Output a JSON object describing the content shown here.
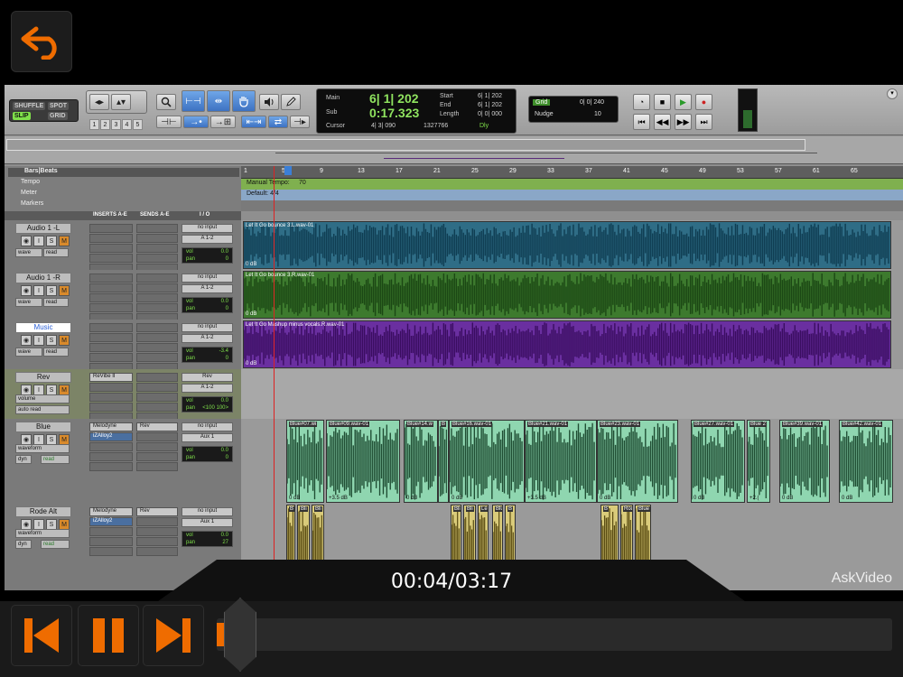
{
  "player": {
    "time_display": "00:04/03:17",
    "progress": 0.02,
    "watermark": "AskVideo",
    "back_icon": "back-arrow-icon",
    "accent": "#ef6c00"
  },
  "toolbar": {
    "modes": {
      "shuffle": "SHUFFLE",
      "spot": "SPOT",
      "slip": "SLIP",
      "grid": "GRID"
    },
    "zoom_presets": [
      "1",
      "2",
      "3",
      "4",
      "5"
    ],
    "counter": {
      "main_label": "Main",
      "main_value": "6| 1| 202",
      "sub_label": "Sub",
      "sub_value": "0:17.323",
      "cursor_label": "Cursor",
      "cursor_value": "4| 3| 090",
      "cursor_extra": "1327766",
      "start_label": "Start",
      "start_value": "6| 1| 202",
      "end_label": "End",
      "end_value": "6| 1| 202",
      "length_label": "Length",
      "length_value": "0| 0| 000",
      "dly": "Dly"
    },
    "grid": {
      "label": "Grid",
      "value": "0| 0| 240",
      "nudge_label": "Nudge",
      "nudge_value": "10"
    }
  },
  "rulers": {
    "bars_beats": "Bars|Beats",
    "tempo": "Tempo",
    "meter": "Meter",
    "markers": "Markers",
    "tempo_text": "Manual Tempo:",
    "tempo_value": "70",
    "meter_text": "Default: 4/4",
    "ticks": [
      "1",
      "5",
      "9",
      "13",
      "17",
      "21",
      "25",
      "29",
      "33",
      "37",
      "41",
      "45",
      "49",
      "53",
      "57",
      "61",
      "65"
    ]
  },
  "mix_columns": {
    "inserts": "INSERTS A-E",
    "sends": "SENDS A-E",
    "io": "I / O"
  },
  "tracks": [
    {
      "name": "Audio 1 -L",
      "mode": "wave",
      "mode2": "read",
      "input": "no input",
      "output": "A 1-2",
      "vol": "0.0",
      "pan": "0",
      "region": "Let It Go bounce 3.L.wav-01",
      "gain": "0 dB"
    },
    {
      "name": "Audio 1 -R",
      "mode": "wave",
      "mode2": "read",
      "input": "no input",
      "output": "A 1-2",
      "vol": "0.0",
      "pan": "0",
      "region": "Let It Go bounce 3.R.wav-01",
      "gain": "0 dB"
    },
    {
      "name": "Music",
      "mode": "wave",
      "mode2": "read",
      "input": "no input",
      "output": "A 1-2",
      "vol": "-3.4",
      "pan": "0",
      "region": "Let It Go Mashup minus vocals.R.wav-01",
      "gain": "0 dB"
    },
    {
      "name": "Rev",
      "insert": "ReVibe II",
      "mode": "volume",
      "mode2": "auto read",
      "input": "Rev",
      "output": "A 1-2",
      "vol": "0.0",
      "pan": "<100  100>"
    },
    {
      "name": "Blue",
      "insert": "Melodyne",
      "insert2": "iZAlloy2",
      "send": "Rev",
      "mode": "waveform",
      "mode2": "dyn",
      "mode3": "read",
      "input": "no input",
      "output": "Aux 1",
      "vol": "0.0",
      "pan": "0",
      "regions": [
        {
          "name": "Blue#07.wi",
          "gain": "0 dB"
        },
        {
          "name": "Blue#09.wav-01",
          "gain": "+3.5 dB"
        },
        {
          "name": "Blue#14.w",
          "gain": "0 dB"
        },
        {
          "name": "B",
          "gain": ""
        },
        {
          "name": "Blue#16.wav-01",
          "gain": "0 dB"
        },
        {
          "name": "Blue#21.wav-01",
          "gain": "+3.5 dB"
        },
        {
          "name": "Blue#23.wav-01",
          "gain": "0 dB"
        },
        {
          "name": "Blue#27.wav-01",
          "gain": "0 dB"
        },
        {
          "name": "Blue 2",
          "gain": "+2.("
        },
        {
          "name": "Blue#39.wav-01",
          "gain": "0 dB"
        },
        {
          "name": "Blue#42.wav-01",
          "gain": "0 dB"
        }
      ]
    },
    {
      "name": "Rode Alt",
      "insert": "Melodyne",
      "insert2": "iZAlloy2",
      "send": "Rev",
      "mode": "waveform",
      "mode2": "dyn",
      "mode3": "read",
      "input": "no input",
      "output": "Aux 1",
      "vol": "0.0",
      "pan": "27",
      "regions": [
        {
          "name": "B"
        },
        {
          "name": "Bli"
        },
        {
          "name": "Bli"
        },
        {
          "name": "Bli"
        },
        {
          "name": "Bli"
        },
        {
          "name": "Le"
        },
        {
          "name": "Blue"
        },
        {
          "name": "B"
        },
        {
          "name": "B"
        },
        {
          "name": "Rode#04.wav-01"
        },
        {
          "name": "Blue 2#05.wav-0"
        }
      ]
    }
  ],
  "colors": {
    "audio_l": "#2f6d86",
    "audio_r": "#3d7a2e",
    "music": "#6a2fa0",
    "blue": "#8fd6b0",
    "rode": "#d9cb7a"
  }
}
